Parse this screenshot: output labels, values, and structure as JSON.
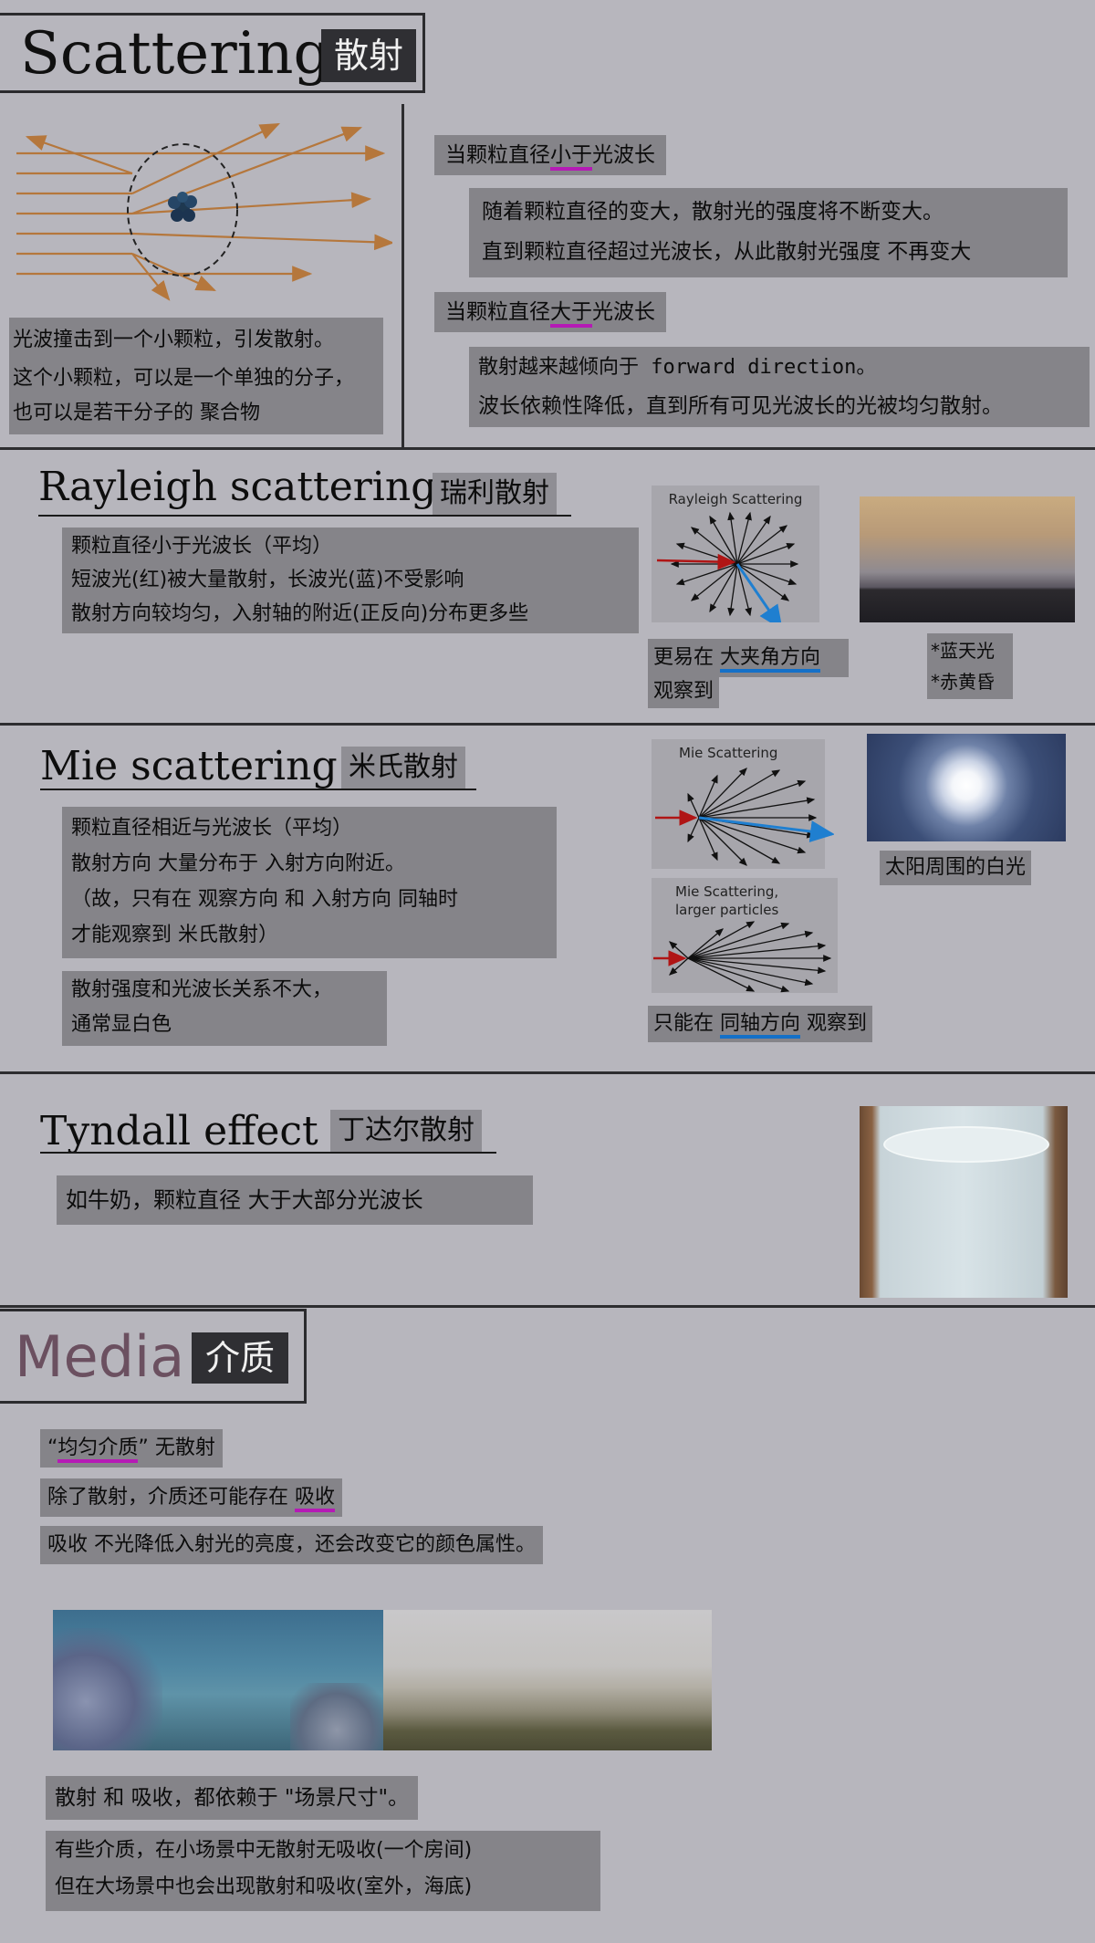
{
  "scattering": {
    "title_en": "Scattering",
    "title_cn": "散射",
    "particle_caption": [
      "光波撞击到一个小颗粒，引发散射。",
      "这个小颗粒，可以是一个单独的分子，",
      "也可以是若干分子的  聚合物"
    ],
    "small": {
      "heading_pre": "当颗粒直径",
      "heading_mark": "小于",
      "heading_post": "光波长",
      "lines": [
        "随着颗粒直径的变大，散射光的强度将不断变大。",
        "直到颗粒直径超过光波长，从此散射光强度  不再变大"
      ]
    },
    "large": {
      "heading_pre": "当颗粒直径",
      "heading_mark": "大于",
      "heading_post": "光波长",
      "lines": [
        "散射越来越倾向于  forward direction。",
        "波长依赖性降低，直到所有可见光波长的光被均匀散射。"
      ]
    }
  },
  "rayleigh": {
    "title_en": "Rayleigh scattering",
    "title_cn": "瑞利散射",
    "lines": [
      "颗粒直径小于光波长（平均）",
      "短波光(红)被大量散射，长波光(蓝)不受影响",
      "散射方向较均匀，入射轴的附近(正反向)分布更多些"
    ],
    "diagram_title": "Rayleigh Scattering",
    "obs_pre": "更易在  ",
    "obs_mark": "大夹角方向",
    "obs_post": "观察到",
    "notes": [
      "*蓝天光",
      "*赤黄昏"
    ]
  },
  "mie": {
    "title_en": "Mie scattering",
    "title_cn": "米氏散射",
    "lines": [
      "颗粒直径相近与光波长（平均）",
      "散射方向  大量分布于  入射方向附近。",
      "（故，只有在  观察方向  和  入射方向  同轴时",
      "才能观察到  米氏散射）"
    ],
    "lines2": [
      "散射强度和光波长关系不大，",
      "通常显白色"
    ],
    "diagram1_title": "Mie Scattering",
    "diagram2_title_1": "Mie Scattering,",
    "diagram2_title_2": "larger particles",
    "obs_pre": "只能在  ",
    "obs_mark": "同轴方向",
    "obs_post": " 观察到",
    "sun_caption": "太阳周围的白光"
  },
  "tyndall": {
    "title_en": "Tyndall effect",
    "title_cn": "丁达尔散射",
    "line": "如牛奶，颗粒直径  大于大部分光波长"
  },
  "media": {
    "title_en": "Media",
    "title_cn": "介质",
    "line1_pre": "“",
    "line1_mark": "均匀介质",
    "line1_post": "” 无散射",
    "line2_pre": "除了散射，介质还可能存在  ",
    "line2_mark": "吸收",
    "line3": "吸收  不光降低入射光的亮度，还会改变它的颜色属性。",
    "line4": "散射  和  吸收，都依赖于  \"场景尺寸\"。",
    "lines5": [
      "有些介质，在小场景中无散射无吸收(一个房间)",
      "但在大场景中也会出现散射和吸收(室外，海底)"
    ]
  },
  "colors": {
    "accent_magenta": "#b51ab5",
    "accent_blue": "#1470c8",
    "arrow_orange": "#b5773c",
    "arrow_red": "#b01515",
    "arrow_blue": "#1f7fd0"
  }
}
